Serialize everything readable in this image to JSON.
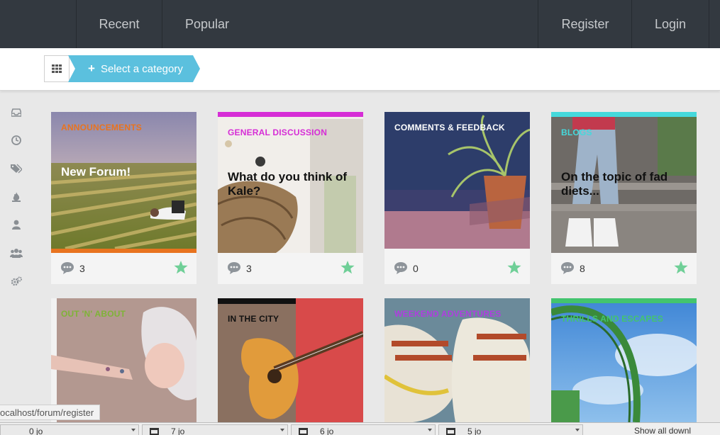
{
  "nav": {
    "recent": "Recent",
    "popular": "Popular",
    "register": "Register",
    "login": "Login"
  },
  "breadcrumb": {
    "select_category": "Select a category"
  },
  "sidebar": {
    "icons": [
      "inbox-icon",
      "clock-icon",
      "tags-icon",
      "fire-icon",
      "user-icon",
      "users-icon",
      "gears-icon"
    ]
  },
  "categories": [
    {
      "label": "ANNOUNCEMENTS",
      "title": "New Forum!",
      "comments": "3",
      "color": "#e8731f"
    },
    {
      "label": "GENERAL DISCUSSION",
      "title": "What do you think of Kale?",
      "comments": "3",
      "color": "#d62dd6"
    },
    {
      "label": "COMMENTS & FEEDBACK",
      "title": "",
      "comments": "0",
      "color": "#ffffff"
    },
    {
      "label": "BLOGS",
      "title": "On the topic of fad diets...",
      "comments": "8",
      "color": "#45d9dc"
    },
    {
      "label": "OUT 'N' ABOUT",
      "title": "",
      "comments": "",
      "color": "#7fb338"
    },
    {
      "label": "IN THE CITY",
      "title": "",
      "comments": "",
      "color": "#111111"
    },
    {
      "label": "WEEKEND ADVENTURES",
      "title": "",
      "comments": "",
      "color": "#b03de0"
    },
    {
      "label": "THRILLS AND ESCAPES",
      "title": "",
      "comments": "",
      "color": "#43c46e"
    }
  ],
  "status_url": "ocalhost/forum/register",
  "taskbar": {
    "items": [
      "0 jo",
      "7 jo",
      "6 jo",
      "5 jo"
    ],
    "right_label": "Show all downl"
  }
}
